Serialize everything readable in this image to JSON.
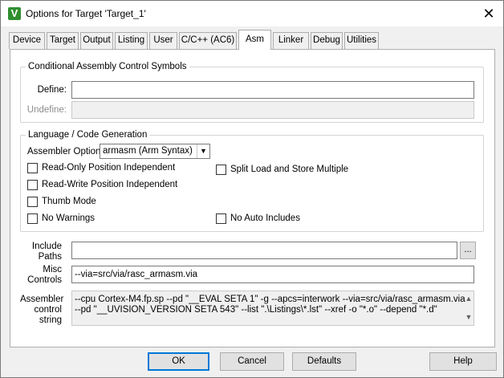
{
  "window": {
    "title": "Options for Target 'Target_1'"
  },
  "tabs": [
    {
      "label": "Device"
    },
    {
      "label": "Target"
    },
    {
      "label": "Output"
    },
    {
      "label": "Listing"
    },
    {
      "label": "User"
    },
    {
      "label": "C/C++ (AC6)"
    },
    {
      "label": "Asm",
      "active": true
    },
    {
      "label": "Linker"
    },
    {
      "label": "Debug"
    },
    {
      "label": "Utilities"
    }
  ],
  "conditional_group": {
    "title": "Conditional Assembly Control Symbols",
    "define_label": "Define:",
    "define_value": "",
    "undefine_label": "Undefine:",
    "undefine_value": ""
  },
  "language_group": {
    "title": "Language / Code Generation",
    "assembler_option_label": "Assembler Option:",
    "assembler_option_value": "armasm (Arm Syntax)",
    "checkboxes": [
      {
        "label": "Read-Only Position Independent",
        "checked": false
      },
      {
        "label": "Read-Write Position Independent",
        "checked": false
      },
      {
        "label": "Thumb Mode",
        "checked": false
      },
      {
        "label": "No Warnings",
        "checked": false
      },
      {
        "label": "Split Load and Store Multiple",
        "checked": false
      },
      {
        "label": "No Auto Includes",
        "checked": false
      }
    ]
  },
  "include_paths": {
    "label_line1": "Include",
    "label_line2": "Paths",
    "value": "",
    "browse_label": "..."
  },
  "misc_controls": {
    "label_line1": "Misc",
    "label_line2": "Controls",
    "value": "--via=src/via/rasc_armasm.via"
  },
  "assembler_control": {
    "label_line1": "Assembler",
    "label_line2": "control",
    "label_line3": "string",
    "line1": "--cpu Cortex-M4.fp.sp --pd \"__EVAL SETA 1\" -g --apcs=interwork --via=src/via/rasc_armasm.via",
    "line2": "--pd \"__UVISION_VERSION SETA 543\" --list \".\\Listings\\*.lst\" --xref -o \"*.o\" --depend \"*.d\""
  },
  "buttons": {
    "ok": "OK",
    "cancel": "Cancel",
    "defaults": "Defaults",
    "help": "Help"
  },
  "colors": {
    "app_icon": "#2f8f2f",
    "default_button_border": "#0078d7"
  },
  "icons": {
    "app": "keil-uvision-icon",
    "close": "close-icon",
    "dropdown": "chevron-down-icon"
  }
}
